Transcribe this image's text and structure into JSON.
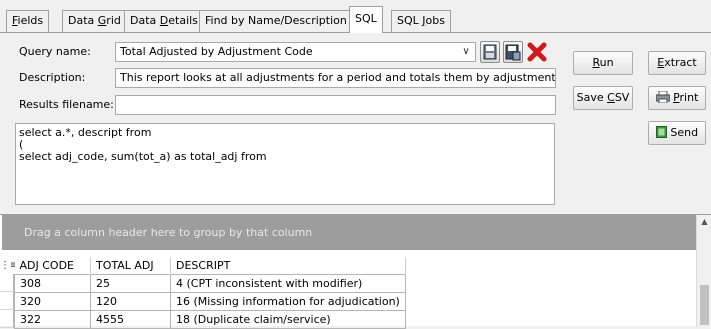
{
  "tabs": [
    {
      "pre": "",
      "ul": "F",
      "post": "ields"
    },
    {
      "pre": "Data ",
      "ul": "G",
      "post": "rid"
    },
    {
      "pre": "Data ",
      "ul": "D",
      "post": "etails"
    },
    {
      "pre": "Find by Name/Description",
      "ul": "",
      "post": ""
    },
    {
      "pre": "SQL",
      "ul": "",
      "post": ""
    },
    {
      "pre": "SQL ",
      "ul": "J",
      "post": "obs"
    }
  ],
  "form": {
    "query_name_label": "Query name:",
    "query_name_value": "Total Adjusted by Adjustment Code",
    "description_label": "Description:",
    "description_value": "This report looks at all adjustments for a period and totals them by adjustment cod",
    "results_label": "Results filename:",
    "results_value": ""
  },
  "buttons": {
    "run": {
      "pre": "",
      "ul": "R",
      "post": "un"
    },
    "extract": {
      "pre": "",
      "ul": "E",
      "post": "xtract"
    },
    "save_csv": {
      "pre": "Save ",
      "ul": "C",
      "post": "SV"
    },
    "print": {
      "pre": "",
      "ul": "P",
      "post": "rint"
    },
    "send": {
      "pre": "Send",
      "ul": "",
      "post": ""
    }
  },
  "sql_text": "select a.*, descript from\n(\nselect adj_code, sum(tot_a) as total_adj from",
  "grid": {
    "group_hint": "Drag a column header here to group by that column",
    "columns": [
      "ADJ CODE",
      "TOTAL ADJ",
      "DESCRIPT"
    ],
    "rows": [
      [
        "308",
        "25",
        "4 (CPT inconsistent with modifier)"
      ],
      [
        "320",
        "120",
        "16 (Missing information for adjudication)"
      ],
      [
        "322",
        "4555",
        "18 (Duplicate claim/service)"
      ]
    ]
  },
  "colors": {
    "delete_icon": "#d01818",
    "group_area": "#9d9d9d",
    "send_icon": "#3a9a3a"
  }
}
